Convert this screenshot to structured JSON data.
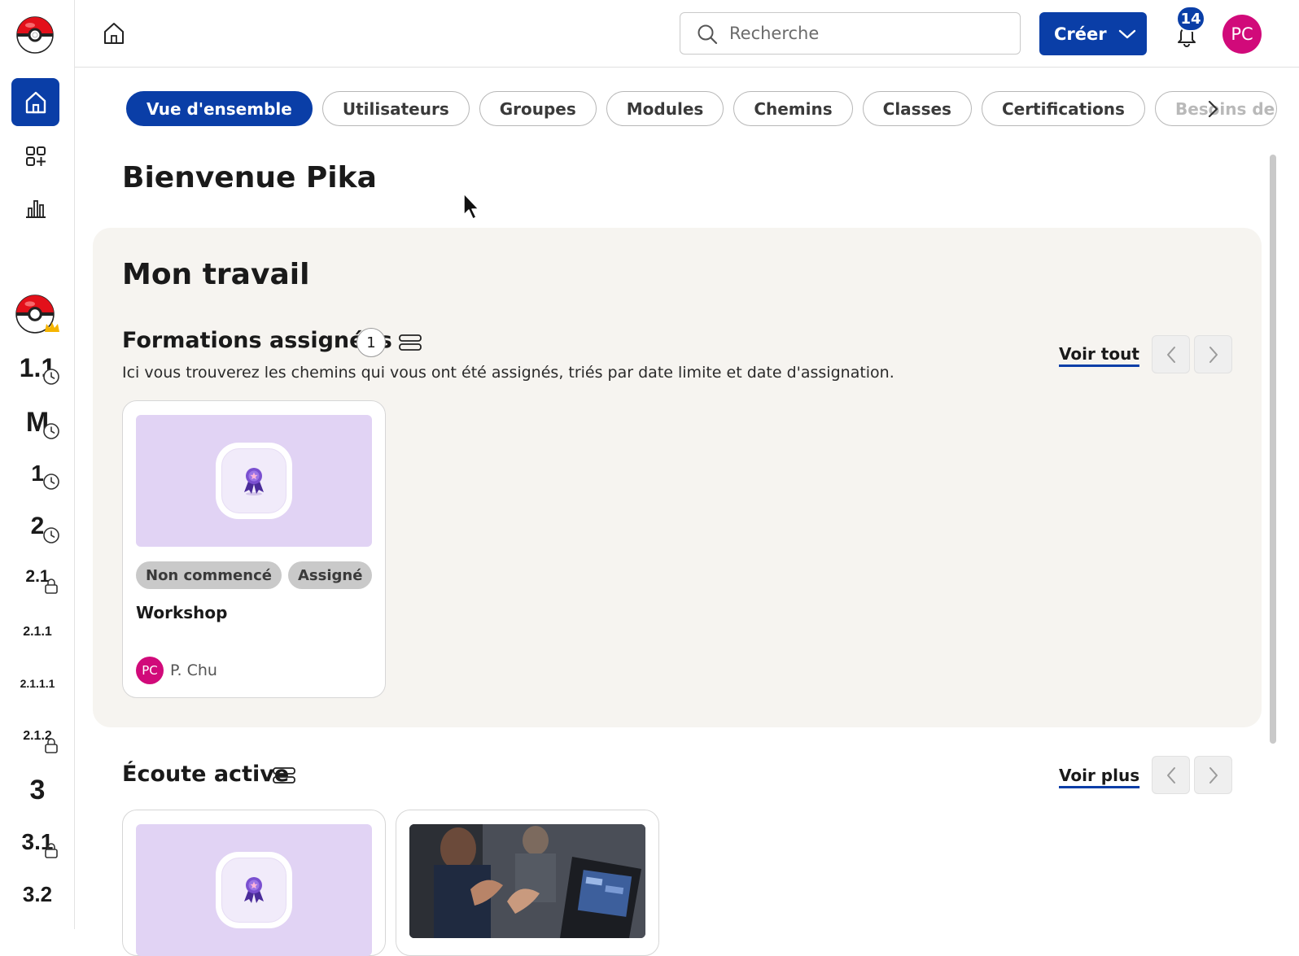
{
  "rail": {
    "items": [
      {
        "label": "1.1",
        "badge": "clock"
      },
      {
        "label": "M",
        "badge": "clock"
      },
      {
        "label": "1",
        "badge": "clock"
      },
      {
        "label": "2",
        "badge": "clock"
      },
      {
        "label": "2.1",
        "badge": "lock"
      },
      {
        "label": "2.1.1",
        "badge": ""
      },
      {
        "label": "2.1.1.1",
        "badge": ""
      },
      {
        "label": "2.1.2",
        "badge": "lock"
      },
      {
        "label": "3",
        "badge": ""
      },
      {
        "label": "3.1",
        "badge": "lock"
      },
      {
        "label": "3.2",
        "badge": ""
      }
    ]
  },
  "topbar": {
    "search_placeholder": "Recherche",
    "create_label": "Créer",
    "notification_count": "14",
    "avatar_initials": "PC"
  },
  "tabs": [
    {
      "label": "Vue d'ensemble",
      "active": true
    },
    {
      "label": "Utilisateurs"
    },
    {
      "label": "Groupes"
    },
    {
      "label": "Modules"
    },
    {
      "label": "Chemins"
    },
    {
      "label": "Classes"
    },
    {
      "label": "Certifications"
    },
    {
      "label": "Besoins de"
    }
  ],
  "main": {
    "welcome": "Bienvenue Pika",
    "work_title": "Mon travail",
    "assigned": {
      "title": "Formations assignées",
      "count": "1",
      "description": "Ici vous trouverez les chemins qui vous ont été assignés, triés par date limite et date d'assignation.",
      "see_all": "Voir tout",
      "card": {
        "tags": [
          "Non commencé",
          "Assigné"
        ],
        "title": "Workshop",
        "author_initials": "PC",
        "author_name": "P. Chu"
      }
    },
    "listening": {
      "title": "Écoute active",
      "see_more": "Voir plus"
    }
  },
  "colors": {
    "primary": "#0a3ea7",
    "avatar": "#d10a7a",
    "panel": "#f6f4f0",
    "thumb": "#e1d3f4"
  }
}
